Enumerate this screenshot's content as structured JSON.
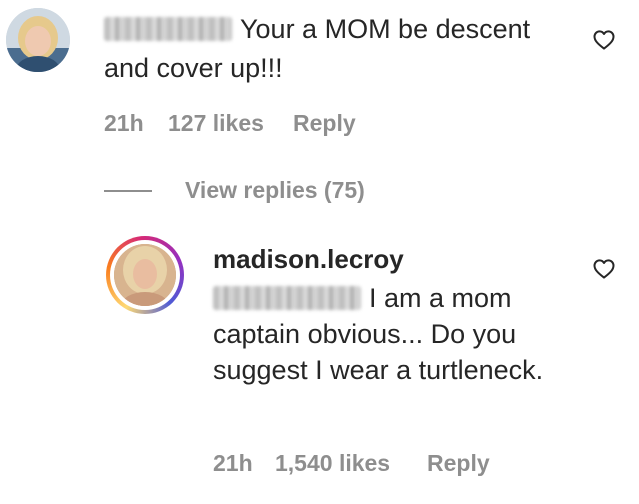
{
  "comment1": {
    "avatar_icon": "user-avatar-photo",
    "text": "Your a MOM be descent and cover up!!!",
    "time": "21h",
    "likes": "127 likes",
    "reply_label": "Reply"
  },
  "view_replies": {
    "label": "View replies (75)"
  },
  "comment2": {
    "avatar_icon": "user-avatar-photo",
    "username": "madison.lecroy",
    "text": "I am a mom captain obvious... Do you suggest I wear a turtleneck.",
    "time": "21h",
    "likes": "1,540 likes",
    "reply_label": "Reply"
  },
  "icons": {
    "like": "heart-outline-icon"
  },
  "colors": {
    "text": "#262626",
    "meta": "#8e8e8e",
    "background": "#ffffff"
  }
}
